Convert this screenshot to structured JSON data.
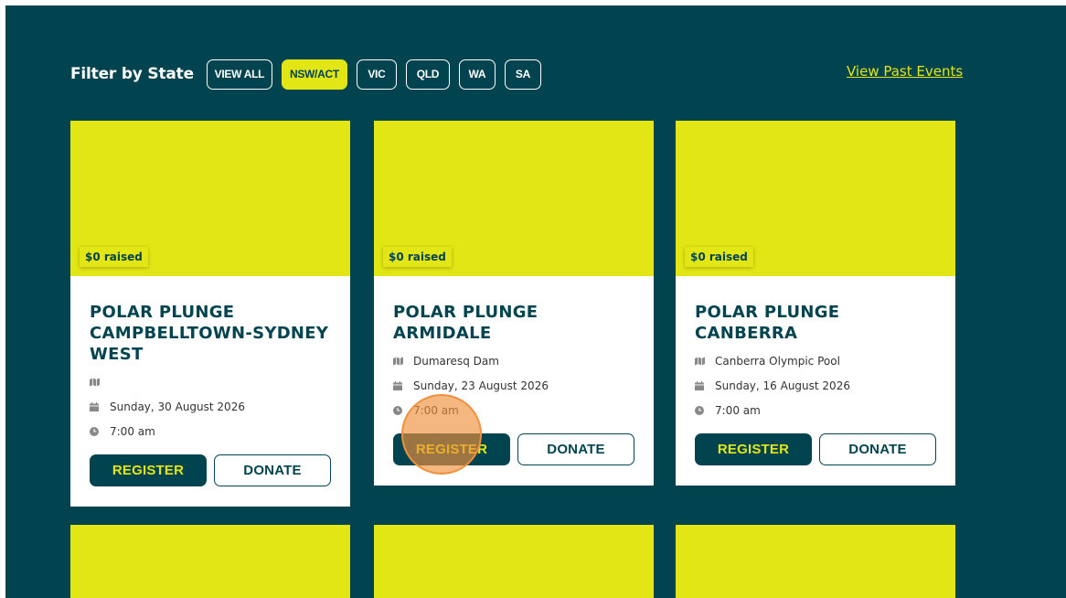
{
  "filter": {
    "label": "Filter by State",
    "options": [
      "VIEW ALL",
      "NSW/ACT",
      "VIC",
      "QLD",
      "WA",
      "SA"
    ],
    "selected": "NSW/ACT"
  },
  "past_events_link": "View Past Events",
  "colors": {
    "background": "#01444f",
    "accent": "#e2e614",
    "card": "#ffffff",
    "click_marker": "#f08f3c"
  },
  "icons": {
    "location": "map-icon",
    "date": "calendar-icon",
    "time": "clock-icon"
  },
  "events": [
    {
      "raised": "$0 raised",
      "title": "POLAR PLUNGE CAMPBELLTOWN-SYDNEY WEST",
      "location": "",
      "date": "Sunday, 30 August 2026",
      "time": "7:00 am",
      "register_label": "REGISTER",
      "donate_label": "DONATE"
    },
    {
      "raised": "$0 raised",
      "title": "POLAR PLUNGE ARMIDALE",
      "location": "Dumaresq Dam",
      "date": "Sunday, 23 August 2026",
      "time": "7:00 am",
      "register_label": "REGISTER",
      "donate_label": "DONATE"
    },
    {
      "raised": "$0 raised",
      "title": "POLAR PLUNGE CANBERRA",
      "location": "Canberra Olympic Pool",
      "date": "Sunday, 16 August 2026",
      "time": "7:00 am",
      "register_label": "REGISTER",
      "donate_label": "DONATE"
    }
  ]
}
